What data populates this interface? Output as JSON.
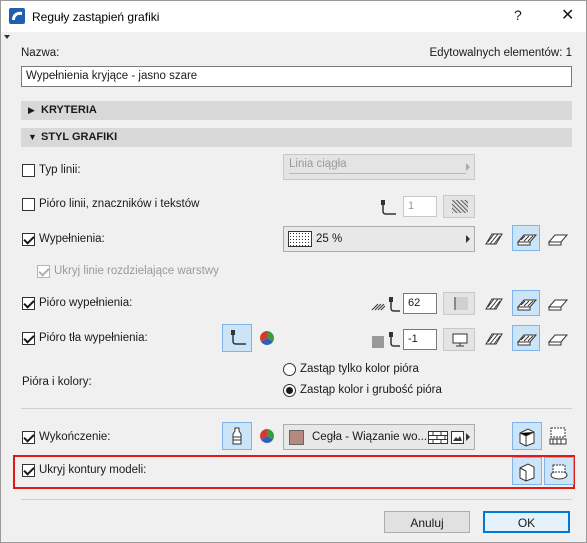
{
  "window": {
    "title": "Reguły zastąpień grafiki",
    "help_glyph": "?",
    "close_glyph": "✕"
  },
  "name_label": "Nazwa:",
  "editable_count": "Edytowalnych elementów: 1",
  "name_value": "Wypełnienia kryjące - jasno szare",
  "sections": {
    "criteria": "KRYTERIA",
    "graphic_style": "STYL GRAFIKI"
  },
  "rows": {
    "line_type": {
      "label": "Typ linii:",
      "checked": false,
      "dropdown": "Linia ciągła"
    },
    "line_pen": {
      "label": "Pióro linii, znaczników i tekstów",
      "checked": false,
      "pen": "1"
    },
    "fill": {
      "label": "Wypełnienia:",
      "checked": true,
      "dropdown": "25 %"
    },
    "hide_layer_lines": {
      "label": "Ukryj linie rozdzielające warstwy",
      "checked": true,
      "disabled": true
    },
    "fill_pen": {
      "label": "Pióro wypełnienia:",
      "checked": true,
      "pen": "62"
    },
    "fill_bg_pen": {
      "label": "Pióro tła wypełnienia:",
      "checked": true,
      "pen": "-1"
    },
    "pens_colors": {
      "label": "Pióra i kolory:",
      "options": [
        "Zastąp tylko kolor pióra",
        "Zastąp kolor i grubość pióra"
      ],
      "selected": 1
    },
    "finish": {
      "label": "Wykończenie:",
      "checked": true,
      "dropdown": "Cegła - Wiązanie wo...",
      "swatch_color": "#b48a7e"
    },
    "hide_contours": {
      "label": "Ukryj kontury modeli:",
      "checked": true
    }
  },
  "buttons": {
    "cancel": "Anuluj",
    "ok": "OK"
  },
  "colors": {
    "accent": "#0078d7",
    "selected_bg": "#cce4f7",
    "highlight_frame": "#e01818",
    "section_bg": "#d8d8d8"
  }
}
